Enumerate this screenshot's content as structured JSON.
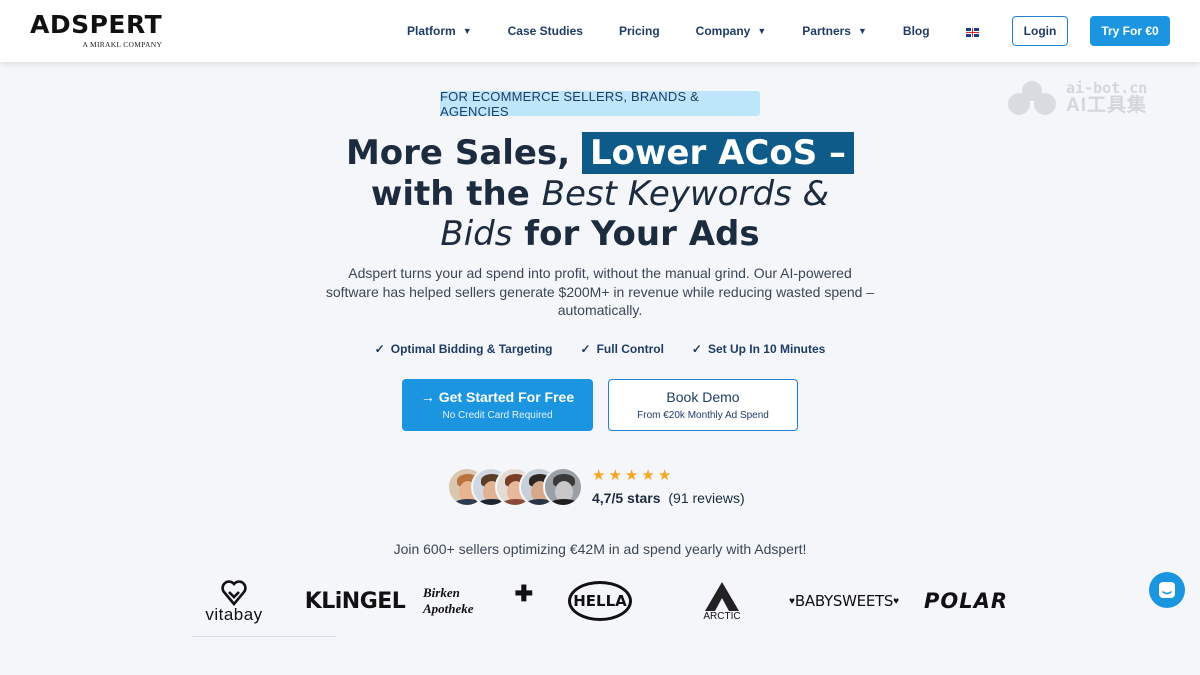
{
  "brand": {
    "name": "ADSPERT",
    "tagline": "A MIRAKL COMPANY"
  },
  "nav": {
    "items": [
      {
        "label": "Platform",
        "dropdown": true
      },
      {
        "label": "Case Studies",
        "dropdown": false
      },
      {
        "label": "Pricing",
        "dropdown": false
      },
      {
        "label": "Company",
        "dropdown": true
      },
      {
        "label": "Partners",
        "dropdown": true
      },
      {
        "label": "Blog",
        "dropdown": false
      }
    ],
    "language_icon": "uk-flag-icon",
    "login_label": "Login",
    "try_label": "Try For €0"
  },
  "watermark": {
    "line1": "ai-bot.cn",
    "line2": "AI工具集"
  },
  "hero": {
    "tag": "FOR ECOMMERCE SELLERS, BRANDS & AGENCIES",
    "headline_part1": "More Sales, ",
    "headline_highlight": "Lower ACoS –",
    "headline_part2": "with the ",
    "headline_italic1": "Best Keywords &",
    "headline_italic2": "Bids",
    "headline_part3": " for Your Ads",
    "subtext": "Adspert turns your ad spend into profit, without the manual grind. Our AI-powered software has helped sellers generate $200M+ in revenue while reducing wasted spend – automatically.",
    "features": [
      "Optimal Bidding & Targeting",
      "Full Control",
      "Set Up In 10 Minutes"
    ],
    "cta_primary": {
      "label": "→ Get Started For Free",
      "sublabel": "No Credit Card Required"
    },
    "cta_secondary": {
      "label": "Book Demo",
      "sublabel": "From €20k Monthly Ad Spend"
    }
  },
  "reviews": {
    "stars": 5,
    "rating_text": "4,7/5 stars",
    "count_text": "(91 reviews)",
    "avatar_count": 5
  },
  "social_proof": {
    "join_text": "Join 600+ sellers optimizing €42M in ad spend yearly with Adspert!",
    "logos": [
      "vitabay",
      "KLiNGEL",
      "Birken Apotheke",
      "HELLA",
      "ARCTIC",
      "BABYSWEETS",
      "POLAR"
    ]
  },
  "colors": {
    "primary": "#1b95e0",
    "navy": "#1f3c66",
    "highlight": "#0e5a88",
    "tag_bg": "#bde6fb",
    "star": "#f5a623",
    "page_bg": "#f4f6fa"
  }
}
